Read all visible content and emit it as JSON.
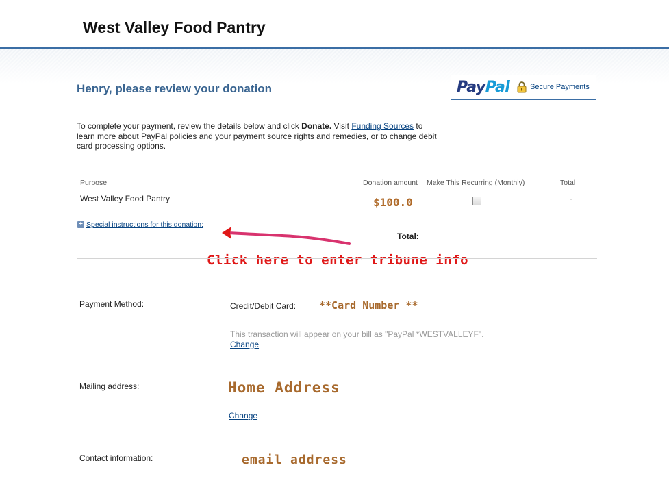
{
  "header": {
    "site_title": "West Valley Food Pantry"
  },
  "review": {
    "heading": "Henry, please review your donation"
  },
  "paypal_badge": {
    "logo_pay": "Pay",
    "logo_pal": "Pal",
    "secure_label": "Secure Payments"
  },
  "intro": {
    "part1": "To complete your payment, review the details below and click ",
    "donate_word": "Donate.",
    "part2": " Visit ",
    "funding_link": "Funding Sources",
    "part3": " to learn more about PayPal policies and your payment source rights and remedies, or to change debit card processing options."
  },
  "table": {
    "headers": {
      "purpose": "Purpose",
      "amount": "Donation amount",
      "recurring": "Make This Recurring (Monthly)",
      "total": "Total"
    },
    "row": {
      "purpose": "West Valley Food Pantry",
      "amount": "$100.0",
      "recurring_checked": false,
      "total": "-"
    },
    "special_instructions_link": "Special instructions for this donation:",
    "total_label": "Total:"
  },
  "annotation": {
    "text": "Click here to enter tribune info"
  },
  "payment": {
    "label": "Payment Method:",
    "card_label": "Credit/Debit Card:",
    "card_number": "**Card Number **",
    "bill_note": "This transaction will appear on your bill as \"PayPal *WESTVALLEYF\".",
    "change": "Change"
  },
  "mailing": {
    "label": "Mailing address:",
    "value": "Home Address",
    "change": "Change"
  },
  "contact": {
    "label": "Contact information:",
    "value": "email address"
  },
  "colors": {
    "brand_blue": "#3b6ea5",
    "heading_blue": "#3a6591",
    "link_blue": "#084482",
    "annotation_red": "#e01818",
    "placeholder_brown": "#a86a2e"
  }
}
